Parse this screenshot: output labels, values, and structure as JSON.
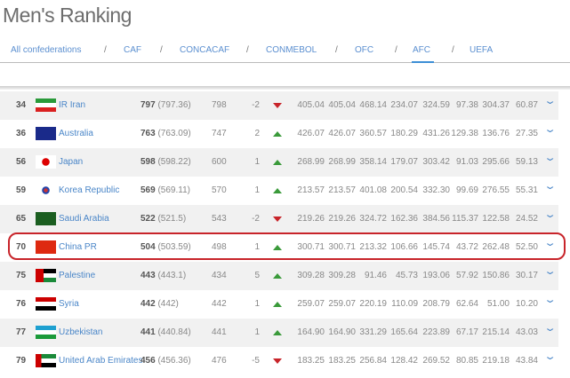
{
  "title": "Men's Ranking",
  "tabs": [
    "All confederations",
    "CAF",
    "CONCACAF",
    "CONMEBOL",
    "OFC",
    "AFC",
    "UEFA"
  ],
  "separator": "/",
  "active_tab": "AFC",
  "colors": {
    "up": "#3a9a3a",
    "down": "#c8242a",
    "link": "#4a86c8",
    "highlight": "#c8242a"
  },
  "rows": [
    {
      "rank": "34",
      "name": "IR Iran",
      "points": "797",
      "points_exact": "(797.36)",
      "prev": "798",
      "change": "-2",
      "dir": "down",
      "vals": [
        "405.04",
        "405.04",
        "468.14",
        "234.07",
        "324.59",
        "97.38",
        "304.37",
        "60.87"
      ]
    },
    {
      "rank": "36",
      "name": "Australia",
      "points": "763",
      "points_exact": "(763.09)",
      "prev": "747",
      "change": "2",
      "dir": "up",
      "vals": [
        "426.07",
        "426.07",
        "360.57",
        "180.29",
        "431.26",
        "129.38",
        "136.76",
        "27.35"
      ]
    },
    {
      "rank": "56",
      "name": "Japan",
      "points": "598",
      "points_exact": "(598.22)",
      "prev": "600",
      "change": "1",
      "dir": "up",
      "vals": [
        "268.99",
        "268.99",
        "358.14",
        "179.07",
        "303.42",
        "91.03",
        "295.66",
        "59.13"
      ]
    },
    {
      "rank": "59",
      "name": "Korea Republic",
      "points": "569",
      "points_exact": "(569.11)",
      "prev": "570",
      "change": "1",
      "dir": "up",
      "vals": [
        "213.57",
        "213.57",
        "401.08",
        "200.54",
        "332.30",
        "99.69",
        "276.55",
        "55.31"
      ]
    },
    {
      "rank": "65",
      "name": "Saudi Arabia",
      "points": "522",
      "points_exact": "(521.5)",
      "prev": "543",
      "change": "-2",
      "dir": "down",
      "vals": [
        "219.26",
        "219.26",
        "324.72",
        "162.36",
        "384.56",
        "115.37",
        "122.58",
        "24.52"
      ]
    },
    {
      "rank": "70",
      "name": "China PR",
      "points": "504",
      "points_exact": "(503.59)",
      "prev": "498",
      "change": "1",
      "dir": "up",
      "vals": [
        "300.71",
        "300.71",
        "213.32",
        "106.66",
        "145.74",
        "43.72",
        "262.48",
        "52.50"
      ]
    },
    {
      "rank": "75",
      "name": "Palestine",
      "points": "443",
      "points_exact": "(443.1)",
      "prev": "434",
      "change": "5",
      "dir": "up",
      "vals": [
        "309.28",
        "309.28",
        "91.46",
        "45.73",
        "193.06",
        "57.92",
        "150.86",
        "30.17"
      ]
    },
    {
      "rank": "76",
      "name": "Syria",
      "points": "442",
      "points_exact": "(442)",
      "prev": "442",
      "change": "1",
      "dir": "up",
      "vals": [
        "259.07",
        "259.07",
        "220.19",
        "110.09",
        "208.79",
        "62.64",
        "51.00",
        "10.20"
      ]
    },
    {
      "rank": "77",
      "name": "Uzbekistan",
      "points": "441",
      "points_exact": "(440.84)",
      "prev": "441",
      "change": "1",
      "dir": "up",
      "vals": [
        "164.90",
        "164.90",
        "331.29",
        "165.64",
        "223.89",
        "67.17",
        "215.14",
        "43.03"
      ]
    },
    {
      "rank": "79",
      "name": "United Arab Emirates",
      "points": "456",
      "points_exact": "(456.36)",
      "prev": "476",
      "change": "-5",
      "dir": "down",
      "vals": [
        "183.25",
        "183.25",
        "256.84",
        "128.42",
        "269.52",
        "80.85",
        "219.18",
        "43.84"
      ]
    }
  ]
}
